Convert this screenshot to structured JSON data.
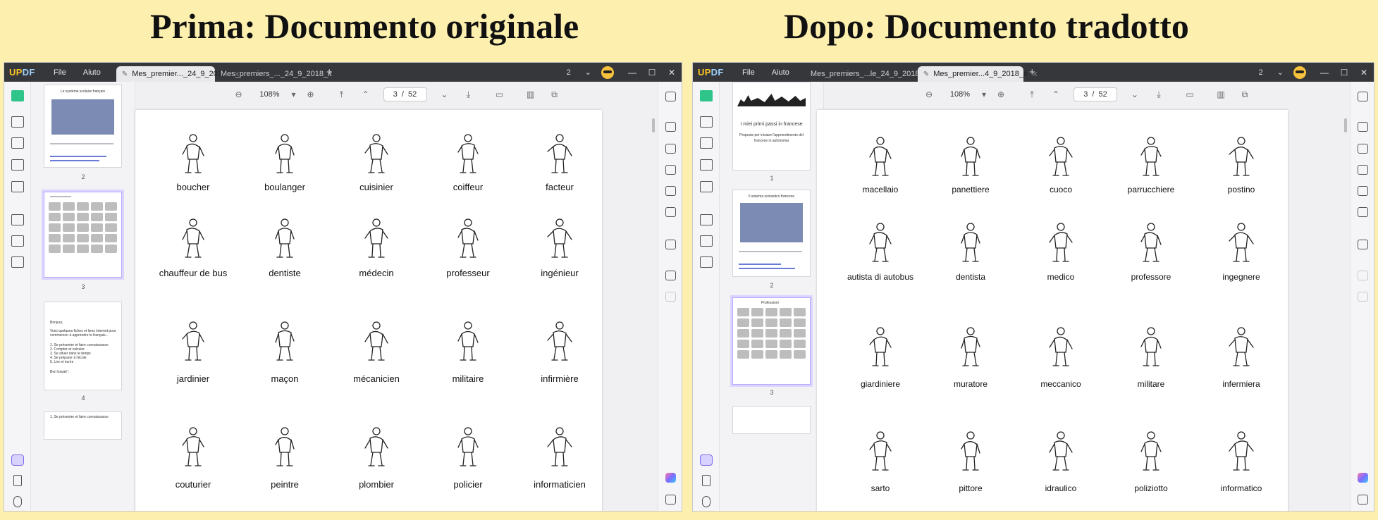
{
  "headings": {
    "left": "Prima: Documento originale",
    "right": "Dopo: Documento tradotto"
  },
  "app": {
    "logo": "UPDF",
    "menu": [
      "File",
      "Aiuto"
    ],
    "page_count_badge": "2",
    "toolbar": {
      "zoom": "108%",
      "page_current": "3",
      "page_sep": "/",
      "page_total": "52"
    }
  },
  "left_window": {
    "tabs": [
      {
        "label": "Mes_premier..._24_9_2018*",
        "active": true
      },
      {
        "label": "Mes_premiers_..._24_9_2018_it",
        "active": false
      }
    ],
    "thumbnails": [
      {
        "number": "2"
      },
      {
        "number": "3",
        "selected": true
      },
      {
        "number": "4"
      }
    ],
    "thumb_text": {
      "p2_title": "Le système scolaire français",
      "p4_line1": "Bonjour,",
      "p4_line2": "Voici quelques fiches et liens internet pour",
      "p4_line3": "commencer à apprendre le français...",
      "p4_list": [
        "1.  Se présenter et faire connaissance",
        "2.  Compter et calculer",
        "3.  Se situer dans le temps",
        "4.  Se préparer à l'école",
        "5.  Lire et écrire"
      ],
      "p4_end": "Bon travail !",
      "p5_line": "1.  Se présenter et faire connaissance"
    },
    "rows": [
      [
        "boucher",
        "boulanger",
        "cuisinier",
        "coiffeur",
        "facteur"
      ],
      [
        "chauffeur de bus",
        "dentiste",
        "médecin",
        "professeur",
        "ingénieur"
      ],
      [
        "jardinier",
        "maçon",
        "mécanicien",
        "militaire",
        "infirmière"
      ],
      [
        "couturier",
        "peintre",
        "plombier",
        "policier",
        "informaticien"
      ]
    ]
  },
  "right_window": {
    "tabs": [
      {
        "label": "Mes_premiers_...le_24_9_2018*",
        "active": false
      },
      {
        "label": "Mes_premier...4_9_2018_it",
        "active": true
      }
    ],
    "thumbnails": [
      {
        "number": "1"
      },
      {
        "number": "2"
      },
      {
        "number": "3",
        "selected": true
      }
    ],
    "thumb_text": {
      "p1_title": "I miei primi passi in francese",
      "p1_sub1": "Proposte per iniziare l'apprendimento del",
      "p1_sub2": "francese in autonomia",
      "p2_title": "Il sistema scolastico francese",
      "p3_title": "Professioni"
    },
    "rows": [
      [
        "macellaio",
        "panettiere",
        "cuoco",
        "parrucchiere",
        "postino"
      ],
      [
        "autista di autobus",
        "dentista",
        "medico",
        "professore",
        "ingegnere"
      ],
      [
        "giardiniere",
        "muratore",
        "meccanico",
        "militare",
        "infermiera"
      ],
      [
        "sarto",
        "pittore",
        "idraulico",
        "poliziotto",
        "informatico"
      ]
    ]
  },
  "colors": {
    "background": "#fdefae",
    "titlebar": "#36373b",
    "accent_green": "#2fc48a",
    "selection_purple": "#b6a8ff"
  }
}
